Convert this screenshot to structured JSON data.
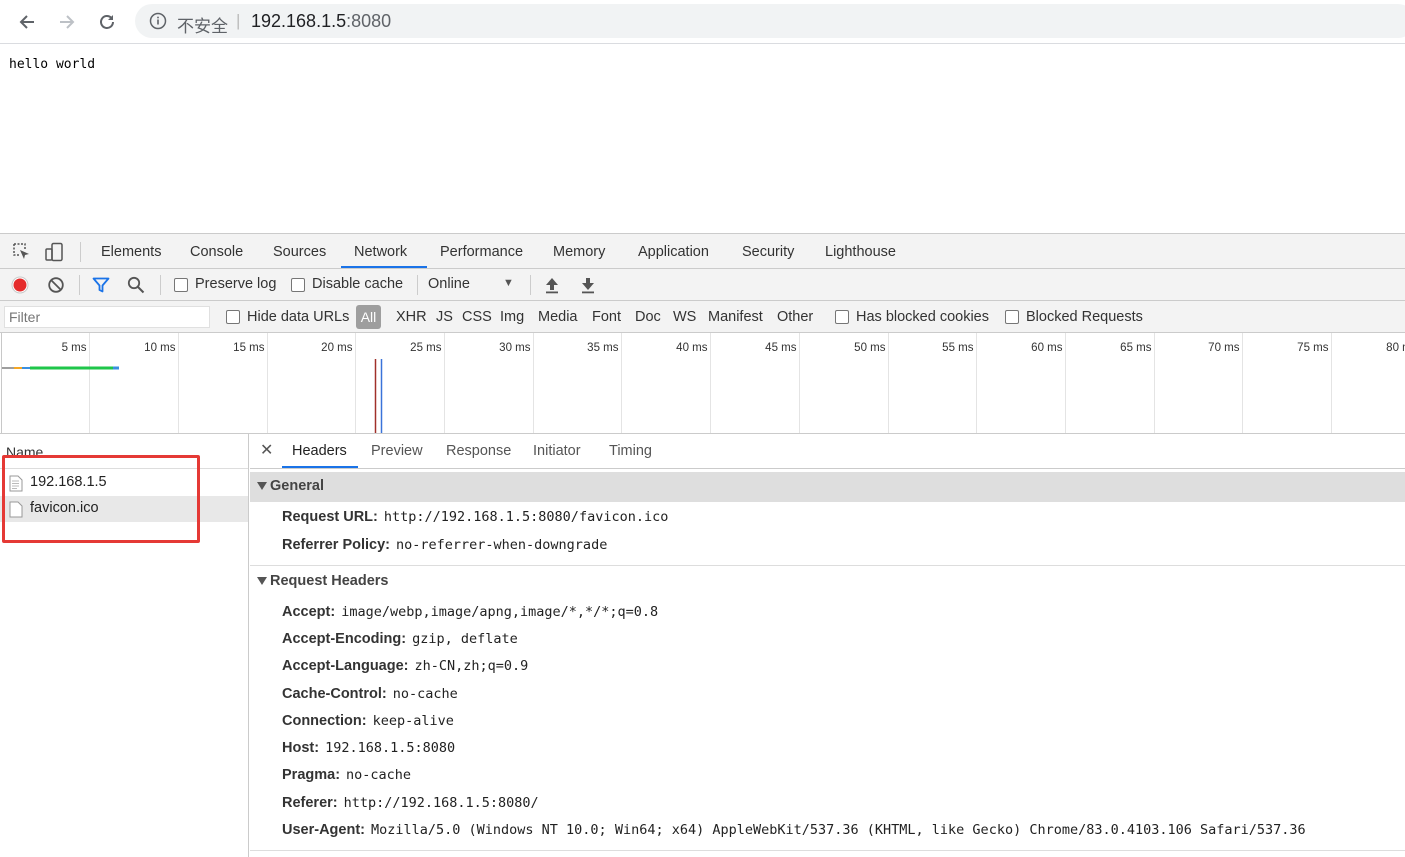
{
  "browser": {
    "security_label": "不安全",
    "separator": "|",
    "url_host": "192.168.1.5",
    "url_port": ":8080"
  },
  "page": {
    "content": "hello world"
  },
  "devtools": {
    "panels": [
      "Elements",
      "Console",
      "Sources",
      "Network",
      "Performance",
      "Memory",
      "Application",
      "Security",
      "Lighthouse"
    ],
    "active_panel": "Network",
    "toolbar": {
      "preserve_log": "Preserve log",
      "disable_cache": "Disable cache",
      "throttling": "Online"
    },
    "filter": {
      "placeholder": "Filter",
      "hide_data_urls": "Hide data URLs",
      "types": [
        "All",
        "XHR",
        "JS",
        "CSS",
        "Img",
        "Media",
        "Font",
        "Doc",
        "WS",
        "Manifest",
        "Other"
      ],
      "active_type": "All",
      "has_blocked_cookies": "Has blocked cookies",
      "blocked_requests": "Blocked Requests"
    },
    "timeline": {
      "ticks": [
        "5 ms",
        "10 ms",
        "15 ms",
        "20 ms",
        "25 ms",
        "30 ms",
        "35 ms",
        "40 ms",
        "45 ms",
        "50 ms",
        "55 ms",
        "60 ms",
        "65 ms",
        "70 ms",
        "75 ms",
        "80 ms"
      ],
      "colors": {
        "bar_green": "#1fc64a",
        "bar_gray": "#9e9e9e",
        "bar_orange": "#f5a623",
        "bar_blue": "#3a8fe0",
        "dom_line": "#3a73d9",
        "load_line": "#a0302a"
      }
    },
    "requests": {
      "column": "Name",
      "rows": [
        {
          "name": "192.168.1.5"
        },
        {
          "name": "favicon.ico"
        }
      ],
      "selected": "favicon.ico"
    },
    "details": {
      "tabs": [
        "Headers",
        "Preview",
        "Response",
        "Initiator",
        "Timing"
      ],
      "active_tab": "Headers",
      "general": {
        "title": "General",
        "rows": [
          {
            "key": "Request URL:",
            "value": "http://192.168.1.5:8080/favicon.ico"
          },
          {
            "key": "Referrer Policy:",
            "value": "no-referrer-when-downgrade"
          }
        ]
      },
      "request_headers": {
        "title": "Request Headers",
        "rows": [
          {
            "key": "Accept:",
            "value": "image/webp,image/apng,image/*,*/*;q=0.8"
          },
          {
            "key": "Accept-Encoding:",
            "value": "gzip, deflate"
          },
          {
            "key": "Accept-Language:",
            "value": "zh-CN,zh;q=0.9"
          },
          {
            "key": "Cache-Control:",
            "value": "no-cache"
          },
          {
            "key": "Connection:",
            "value": "keep-alive"
          },
          {
            "key": "Host:",
            "value": "192.168.1.5:8080"
          },
          {
            "key": "Pragma:",
            "value": "no-cache"
          },
          {
            "key": "Referer:",
            "value": "http://192.168.1.5:8080/"
          },
          {
            "key": "User-Agent:",
            "value": "Mozilla/5.0 (Windows NT 10.0; Win64; x64) AppleWebKit/537.36 (KHTML, like Gecko) Chrome/83.0.4103.106 Safari/537.36"
          }
        ]
      }
    },
    "colors": {
      "accent": "#1a73e8",
      "record": "#e52b2b",
      "highlight_box": "#e53935"
    }
  }
}
